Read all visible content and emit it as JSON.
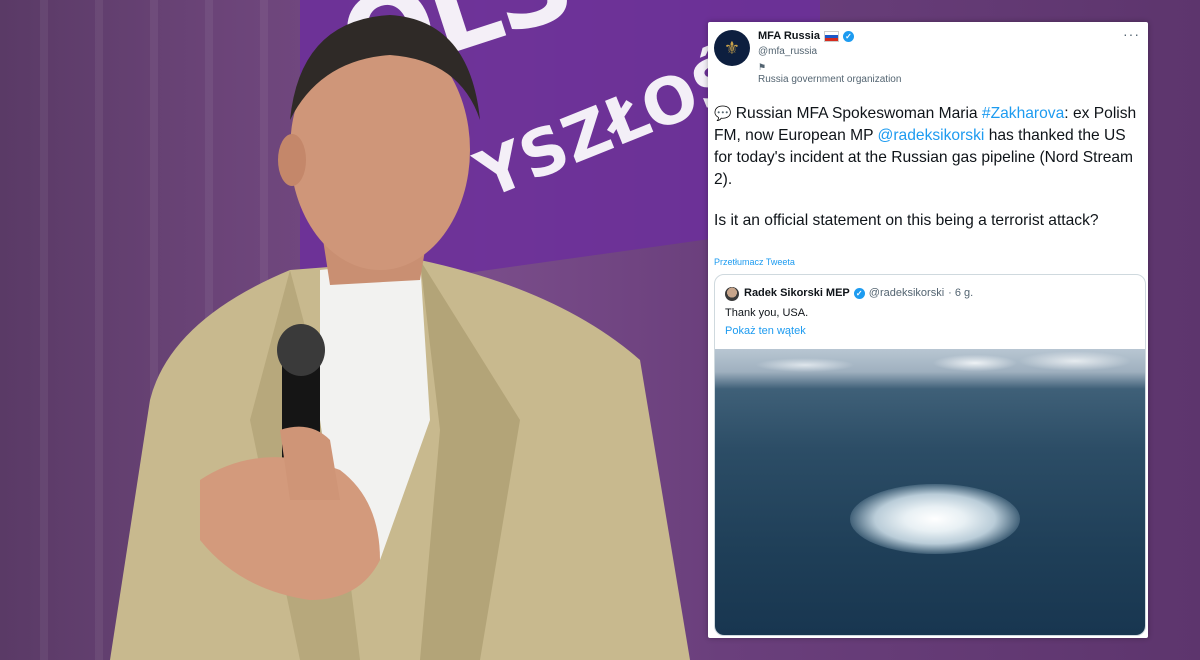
{
  "tweet": {
    "account_name": "MFA Russia",
    "handle": "@mfa_russia",
    "label": "Russia government organization",
    "more_label": "···",
    "text_prefix": "Russian MFA Spokeswoman Maria ",
    "hashtag": "#Zakharova",
    "text_mid": ": ex Polish FM, now European MP ",
    "mention": "@radeksikorski",
    "text_end": " has thanked the US for today's incident at the Russian gas pipeline (Nord Stream 2).",
    "question": "Is it an official statement on this being a terrorist attack?",
    "translate_label": "Przetłumacz Tweeta"
  },
  "quote": {
    "name": "Radek Sikorski MEP",
    "handle": "@radeksikorski",
    "time": "· 6 g.",
    "text": "Thank you, USA.",
    "thread_link": "Pokaż ten wątek"
  },
  "background": {
    "banner_text_1": "OLS",
    "banner_text_2": "YSZŁOŚ"
  },
  "colors": {
    "link": "#1d9bf0",
    "banner": "#6c2f9b",
    "background": "#6b4478"
  }
}
